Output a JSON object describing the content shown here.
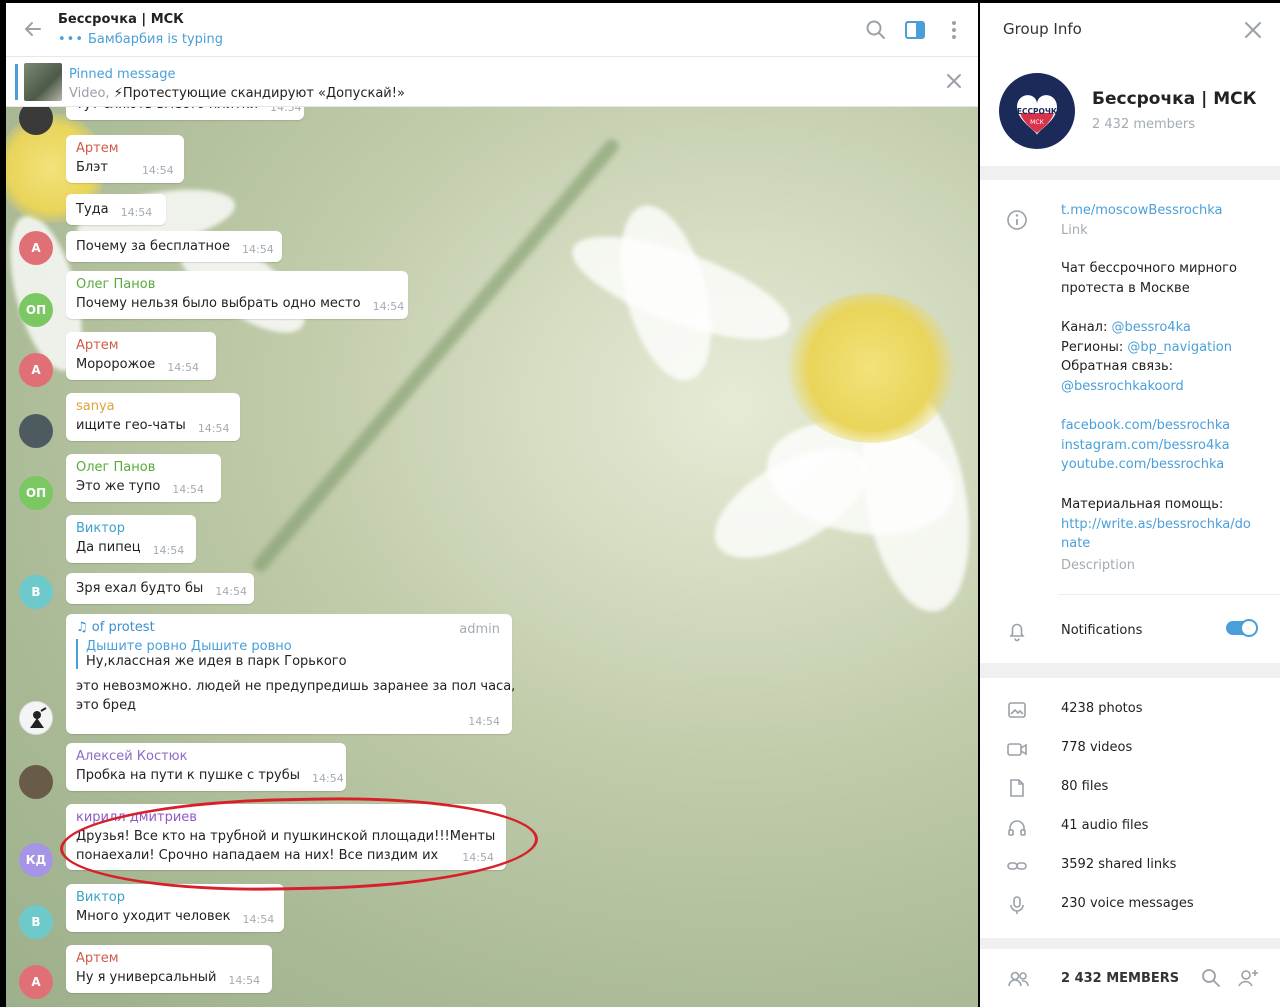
{
  "chat": {
    "title": "Бессрочка | МСК",
    "status": "Бамбарбия is typing",
    "pinned": {
      "title": "Pinned message",
      "prefix": "Video,",
      "text": "⚡Протестующие скандируют «Допускай!»"
    },
    "messages": [
      {
        "avatar": "",
        "avatar_color": "#3a3a3a",
        "sender": "",
        "sender_color": "#c0392b",
        "text": "тут сляють вместо плитки",
        "time": "14:54"
      },
      {
        "avatar": "",
        "avatar_color": "",
        "sender": "Артем",
        "sender_color": "#d05a49",
        "text": "Блэт",
        "time": "14:54"
      },
      {
        "avatar": "",
        "avatar_color": "",
        "sender": "",
        "sender_color": "",
        "text": "Туда",
        "time": "14:54"
      },
      {
        "avatar": "А",
        "avatar_color": "#e17076",
        "sender": "",
        "sender_color": "",
        "text": "Почему за бесплатное",
        "time": "14:54"
      },
      {
        "avatar": "ОП",
        "avatar_color": "#7bc862",
        "sender": "Олег Панов",
        "sender_color": "#5aaa3c",
        "text": "Почему нельзя было выбрать одно место",
        "time": "14:54"
      },
      {
        "avatar": "А",
        "avatar_color": "#e17076",
        "sender": "Артем",
        "sender_color": "#d05a49",
        "text": "Моророжое",
        "time": "14:54"
      },
      {
        "avatar": "",
        "avatar_color": "#4d5a60",
        "sender": "sanya",
        "sender_color": "#e0a23a",
        "text": "ищите гео-чаты",
        "time": "14:54"
      },
      {
        "avatar": "ОП",
        "avatar_color": "#7bc862",
        "sender": "Олег Панов",
        "sender_color": "#5aaa3c",
        "text": "Это же тупо",
        "time": "14:54"
      },
      {
        "avatar": "",
        "avatar_color": "",
        "sender": "Виктор",
        "sender_color": "#3ba2c9",
        "text": "Да пипец",
        "time": "14:54"
      },
      {
        "avatar": "В",
        "avatar_color": "#6ec9cb",
        "sender": "",
        "sender_color": "",
        "text": "Зря ехал будто бы",
        "time": "14:54"
      },
      {
        "avatar": "",
        "avatar_color": "#f4f4f4",
        "sender": "♫ of protest",
        "sender_color": "#3a8fd0",
        "admin": "admin",
        "reply_name": "Дышите ровно Дышите ровно",
        "reply_text": "Ну,классная же идея в парк Горького",
        "text_lines": [
          "это невозможно. людей не предупредишь заранее за пол часа,",
          "это бред"
        ],
        "time": "14:54"
      },
      {
        "avatar": "",
        "avatar_color": "#6a5a48",
        "sender": "Алексей Костюк",
        "sender_color": "#8e6bc9",
        "text": "Пробка на пути к пушке с трубы",
        "time": "14:54"
      },
      {
        "avatar": "КД",
        "avatar_color": "#a695e7",
        "sender": "кирилл дмитриев",
        "sender_color": "#8e5ac9",
        "text_lines": [
          "Друзья!  Все кто на трубной и пушкинской площади!!!Менты",
          "понаехали! Срочно нападаем на них! Все пиздим их"
        ],
        "time": "14:54"
      },
      {
        "avatar": "В",
        "avatar_color": "#6ec9cb",
        "sender": "Виктор",
        "sender_color": "#3ba2c9",
        "text": "Много уходит человек",
        "time": "14:54"
      },
      {
        "avatar": "А",
        "avatar_color": "#e17076",
        "sender": "Артем",
        "sender_color": "#d05a49",
        "text": "Ну я универсальный",
        "time": "14:54"
      }
    ]
  },
  "info": {
    "panel_title": "Group Info",
    "group_name": "Бессрочка | МСК",
    "members": "2 432 members",
    "logo_text": "БЕССРОЧКА",
    "logo_sub": "МСК",
    "link": "t.me/moscowBessrochka",
    "link_label": "Link",
    "desc_lines": [
      "Чат бессрочного мирного",
      "протеста в Москве"
    ],
    "channel_label": "Канал:",
    "channel": "@bessro4ka",
    "regions_label": "Регионы:",
    "regions": "@bp_navigation",
    "feedback_label": "Обратная связь:",
    "feedback": "@bessrochkakoord",
    "social": [
      "facebook.com/bessrochka",
      "instagram.com/bessro4ka",
      "youtube.com/bessrochka"
    ],
    "help_label": "Материальная помощь:",
    "help_link_1": "http://write.as/bessrochka/do",
    "help_link_2": "nate",
    "description_label": "Description",
    "notifications_label": "Notifications",
    "notifications_on": true,
    "media": [
      "4238 photos",
      "778 videos",
      "80 files",
      "41 audio files",
      "3592 shared links",
      "230 voice messages"
    ],
    "members_footer": "2 432 MEMBERS"
  },
  "colors": {
    "accent": "#4a9fd8",
    "highlight_circle": "#d8202a"
  }
}
